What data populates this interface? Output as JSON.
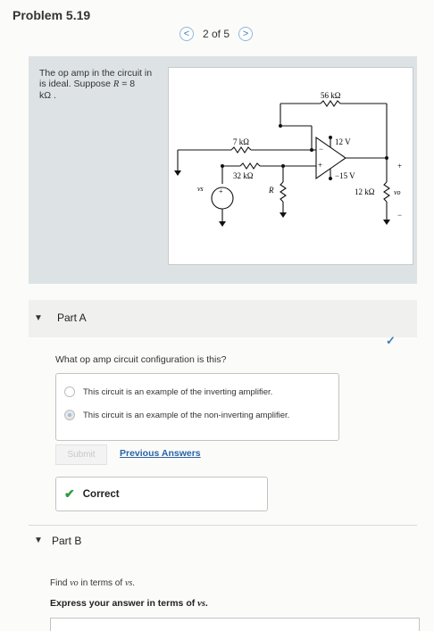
{
  "header": {
    "title": "Problem 5.19"
  },
  "pager": {
    "prev": "<",
    "text": "2 of 5",
    "next": ">"
  },
  "problem": {
    "line1": "The op amp in the circuit in",
    "line2": "is ideal. Suppose",
    "var": "R",
    "eq": " = 8",
    "unit": "kΩ ."
  },
  "circuit": {
    "r56": "56 kΩ",
    "r7": "7 kΩ",
    "r32": "32 kΩ",
    "rR": "R",
    "vs": "vs",
    "v12": "12 V",
    "vneg15": "−15 V",
    "r12": "12 kΩ",
    "vo": "vo",
    "plus": "+",
    "minus": "−"
  },
  "partA": {
    "label": "Part A",
    "question": "What op amp circuit configuration is this?",
    "options": [
      "This circuit is an example of the inverting amplifier.",
      "This circuit is an example of the non-inverting amplifier."
    ],
    "selected_index": 1,
    "submit": "Submit",
    "previous_answers": "Previous Answers",
    "result": "Correct"
  },
  "partB": {
    "label": "Part B",
    "find_pre": "Find ",
    "find_v1": "vo",
    "find_mid": " in terms of ",
    "find_v2": "vs",
    "find_end": ".",
    "express_pre": "Express your answer in terms of ",
    "express_v": "vs",
    "express_end": "."
  },
  "colors": {
    "accent": "#3a7fb6",
    "correct": "#2f9a3b",
    "panel": "#dde3e5"
  }
}
